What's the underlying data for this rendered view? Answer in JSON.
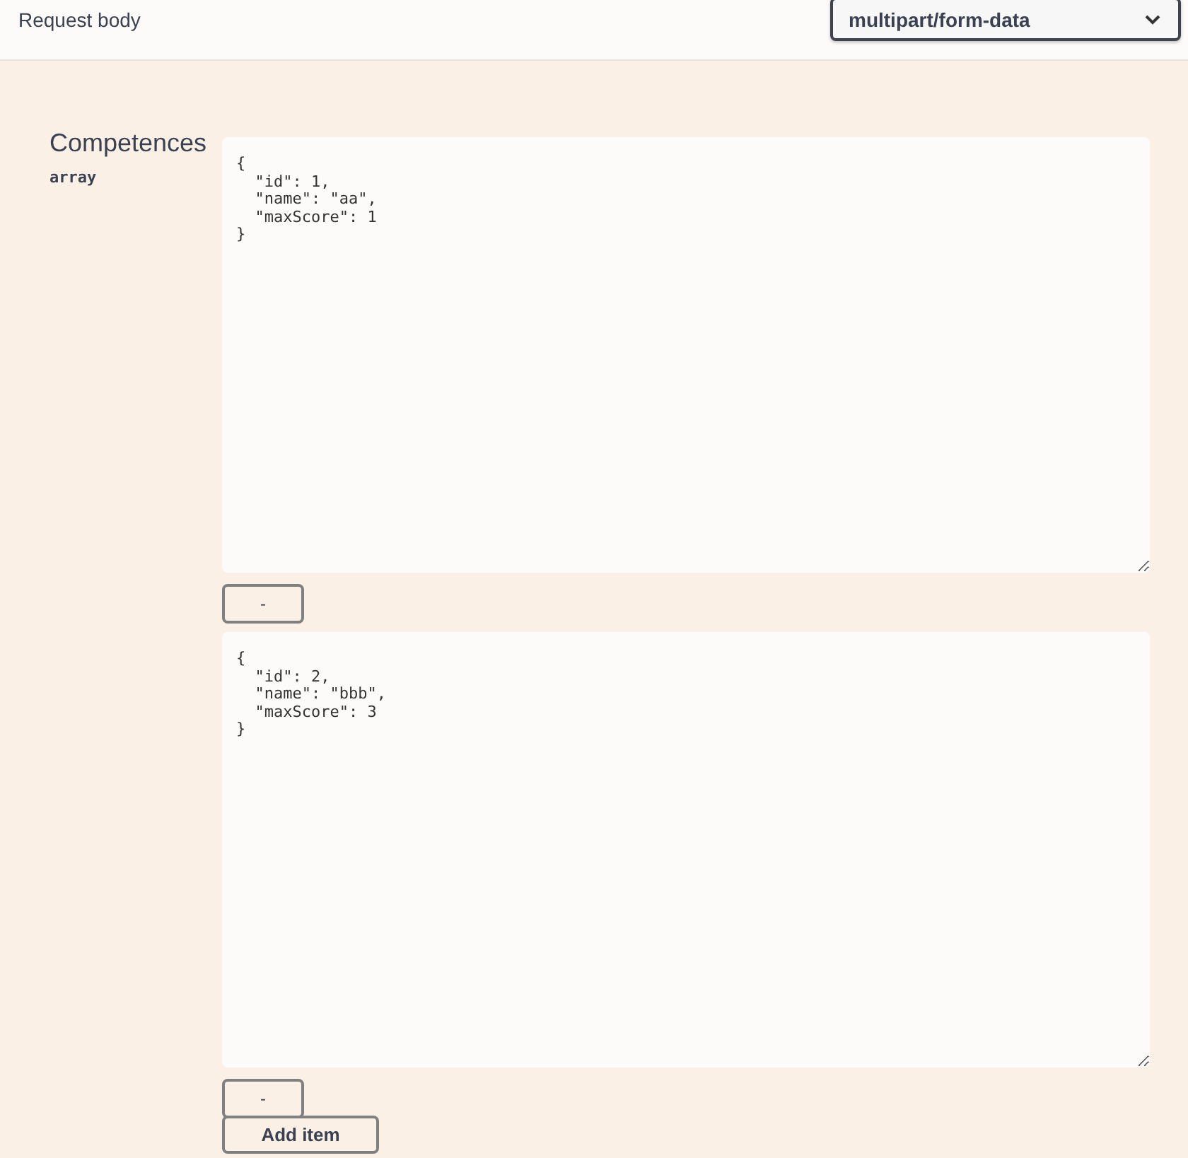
{
  "header": {
    "title": "Request body",
    "content_type": "multipart/form-data"
  },
  "parameter": {
    "name": "Competences",
    "type": "array",
    "items": [
      {
        "value": "{\n  \"id\": 1,\n  \"name\": \"aa\",\n  \"maxScore\": 1\n}",
        "remove_label": "-"
      },
      {
        "value": "{\n  \"id\": 2,\n  \"name\": \"bbb\",\n  \"maxScore\": 3\n}",
        "remove_label": "-"
      }
    ],
    "add_label": "Add item"
  }
}
